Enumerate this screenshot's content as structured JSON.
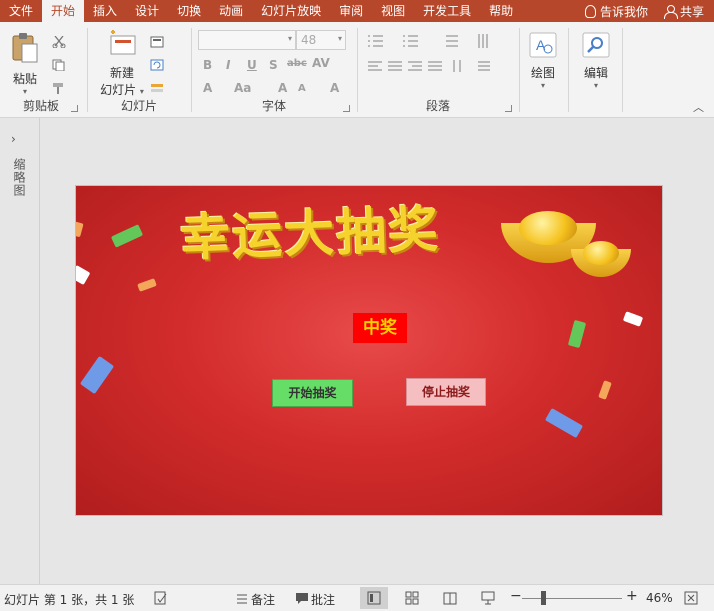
{
  "menu": {
    "tabs": [
      "文件",
      "开始",
      "插入",
      "设计",
      "切换",
      "动画",
      "幻灯片放映",
      "审阅",
      "视图",
      "开发工具",
      "帮助"
    ],
    "active_tab": "开始",
    "tell_me": "告诉我你",
    "share": "共享"
  },
  "ribbon": {
    "clipboard": {
      "label": "剪贴板",
      "paste": "粘贴"
    },
    "slides": {
      "label": "幻灯片",
      "new_slide_line1": "新建",
      "new_slide_line2": "幻灯片"
    },
    "font": {
      "label": "字体",
      "size_value": "48"
    },
    "paragraph": {
      "label": "段落"
    },
    "drawing": {
      "label": "绘图"
    },
    "editing": {
      "label": "编辑"
    }
  },
  "thumbnail_pane": {
    "label": "缩略图"
  },
  "slide": {
    "title": "幸运大抽奖",
    "prize_text": "中奖",
    "start_button": "开始抽奖",
    "stop_button": "停止抽奖",
    "colors": {
      "background": "#d32c2c",
      "title": "#f6d22d",
      "prize_bg": "#ff0000",
      "start_bg": "#66dd66",
      "stop_bg": "#f5bfc2"
    }
  },
  "statusbar": {
    "slide_info": "幻灯片 第 1 张，共 1 张",
    "notes": "备注",
    "comments": "批注",
    "zoom": "46%"
  }
}
